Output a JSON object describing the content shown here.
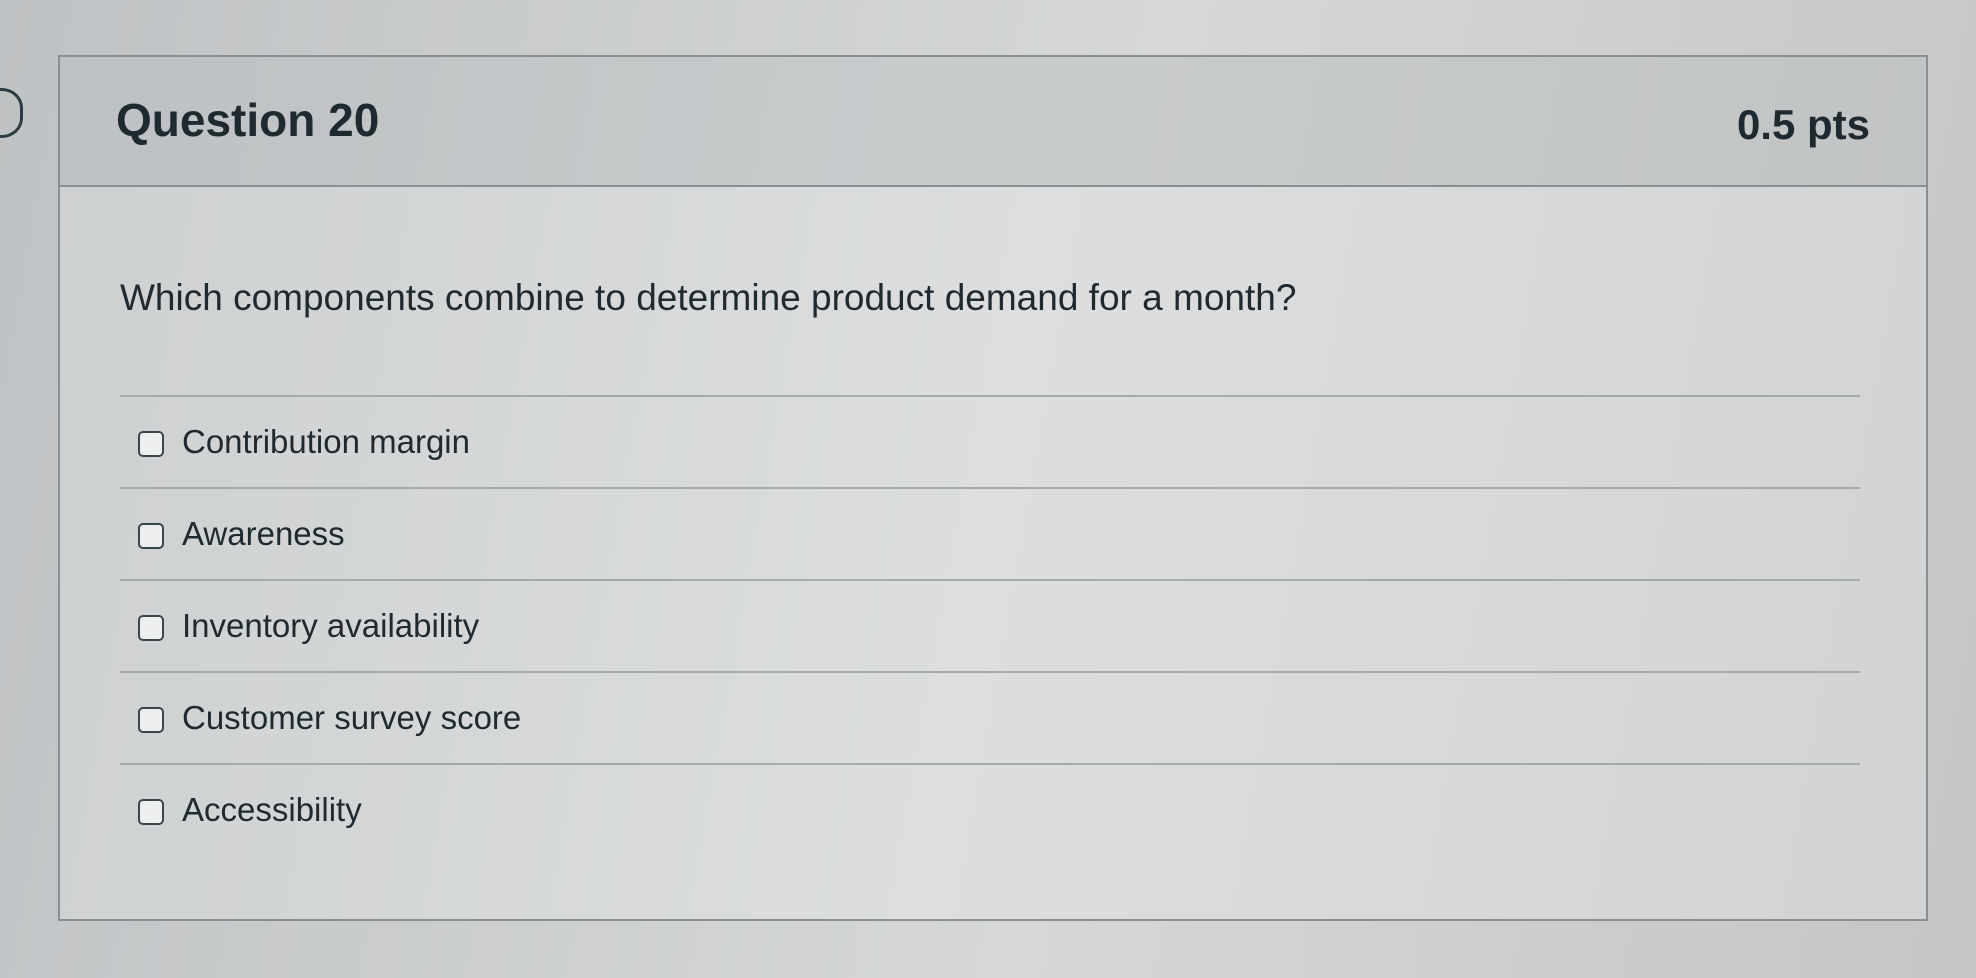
{
  "question": {
    "title": "Question 20",
    "points": "0.5 pts",
    "text": "Which components combine to determine product demand for a month?"
  },
  "answers": [
    {
      "label": "Contribution margin",
      "checked": false
    },
    {
      "label": "Awareness",
      "checked": false
    },
    {
      "label": "Inventory availability",
      "checked": false
    },
    {
      "label": "Customer survey score",
      "checked": false
    },
    {
      "label": "Accessibility",
      "checked": false
    }
  ],
  "icons": {
    "bookmark": "bookmark-flag-icon",
    "checkbox": "checkbox-icon"
  }
}
